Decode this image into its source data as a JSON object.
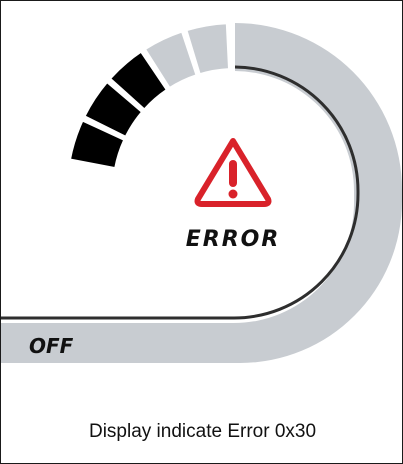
{
  "display": {
    "status_text": "ERROR",
    "mode_text": "OFF",
    "gauge": {
      "segments_total": 5,
      "segments_filled": 3
    },
    "colors": {
      "arc_gray": "#c8ccd1",
      "segment_filled": "#000000",
      "warning_red": "#d9222a",
      "inner_line": "#2e2e2e"
    },
    "icons": {
      "warning": "warning-triangle-icon"
    }
  },
  "caption": "Display indicate Error 0x30"
}
